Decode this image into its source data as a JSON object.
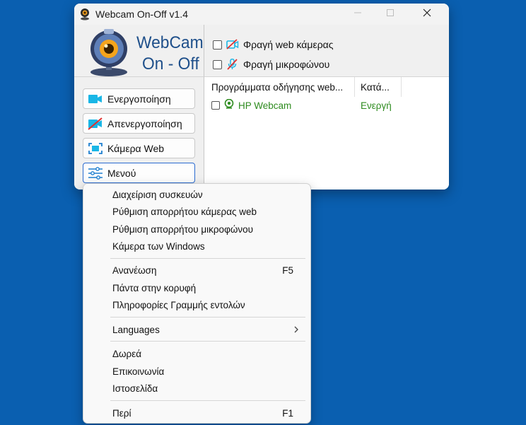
{
  "window": {
    "title": "Webcam On-Off v1.4",
    "logo_line1": "WebCam",
    "logo_line2": "On - Off"
  },
  "options": {
    "block_webcam": "Φραγή web κάμερας",
    "block_microphone": "Φραγή μικροφώνου"
  },
  "buttons": {
    "enable": "Ενεργοποίηση",
    "disable": "Απενεργοποίηση",
    "webcam": "Κάμερα Web",
    "menu": "Μενού"
  },
  "list": {
    "columns": [
      "Προγράμματα οδήγησης web...",
      "Κατά..."
    ],
    "rows": [
      {
        "name": "HP Webcam",
        "status": "Ενεργή"
      }
    ]
  },
  "menu": {
    "items": [
      {
        "label": "Διαχείριση συσκευών",
        "shortcut": ""
      },
      {
        "label": "Ρύθμιση απορρήτου κάμερας web",
        "shortcut": ""
      },
      {
        "label": "Ρύθμιση απορρήτου μικροφώνου",
        "shortcut": ""
      },
      {
        "label": "Κάμερα των Windows",
        "shortcut": ""
      },
      {
        "label": "Ανανέωση",
        "shortcut": "F5"
      },
      {
        "label": "Πάντα στην κορυφή",
        "shortcut": ""
      },
      {
        "label": "Πληροφορίες Γραμμής εντολών",
        "shortcut": ""
      },
      {
        "label": "Languages",
        "shortcut": ""
      },
      {
        "label": "Δωρεά",
        "shortcut": ""
      },
      {
        "label": "Επικοινωνία",
        "shortcut": ""
      },
      {
        "label": "Ιστοσελίδα",
        "shortcut": ""
      },
      {
        "label": "Περί",
        "shortcut": "F1"
      }
    ]
  },
  "colors": {
    "desktop": "#0a5fb0",
    "active_green": "#2e8b1f",
    "accent_blue": "#2a6bd0",
    "icon_cyan": "#19b6e6"
  }
}
